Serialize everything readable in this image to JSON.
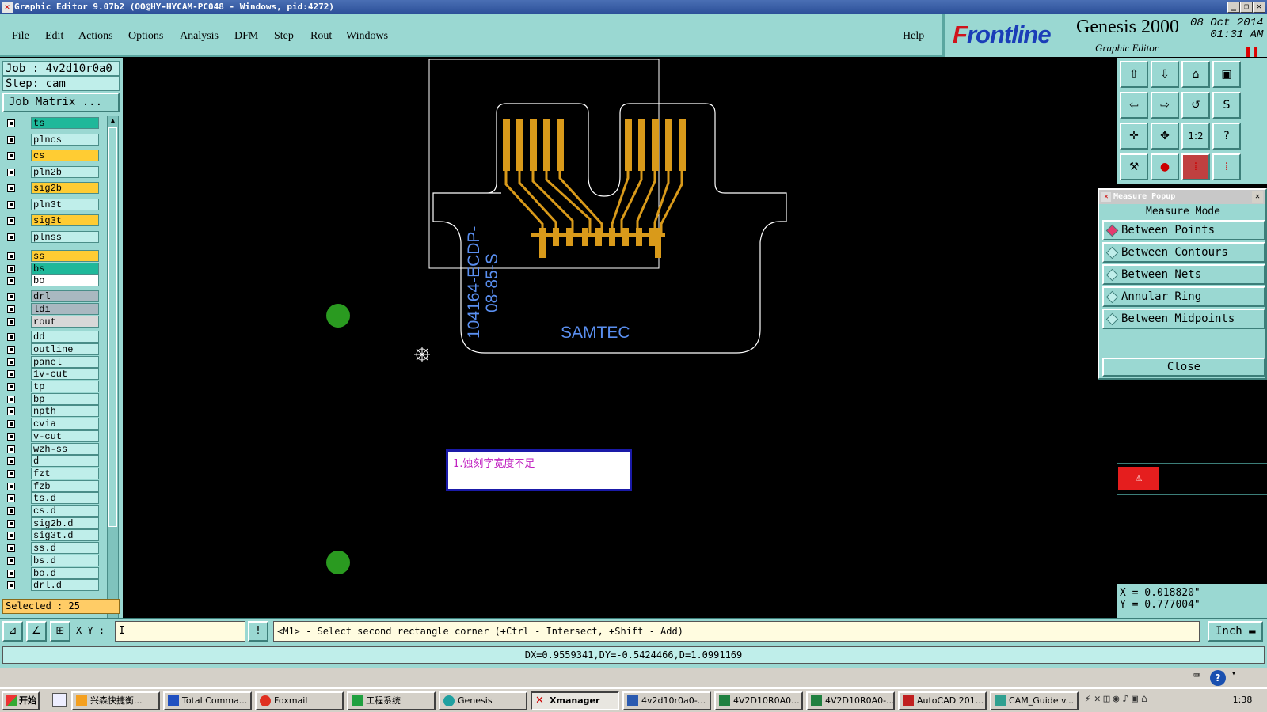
{
  "window": {
    "title": "Graphic Editor 9.07b2 (OO@HY-HYCAM-PC048 - Windows, pid:4272)"
  },
  "menu": {
    "items": [
      "File",
      "Edit",
      "Actions",
      "Options",
      "Analysis",
      "DFM",
      "Step",
      "Rout",
      "Windows"
    ],
    "help": "Help"
  },
  "brand": {
    "logo_prefix": "F",
    "logo_rest": "rontline",
    "product": "Genesis 2000",
    "subtitle": "Graphic Editor",
    "date": "08 Oct 2014",
    "time": "01:31 AM"
  },
  "job": {
    "job_line": "Job : 4v2d10r0a0",
    "step_line": "Step: cam",
    "matrix_button": "Job Matrix ...",
    "selected": "Selected : 25"
  },
  "layers": [
    {
      "name": "ts",
      "color": "#1fb89a"
    },
    {
      "name": "plncs",
      "color": "#bfeeea"
    },
    {
      "name": "cs",
      "color": "#ffcc33"
    },
    {
      "name": "pln2b",
      "color": "#bfeeea"
    },
    {
      "name": "sig2b",
      "color": "#ffcc33"
    },
    {
      "name": "pln3t",
      "color": "#bfeeea"
    },
    {
      "name": "sig3t",
      "color": "#ffcc33"
    },
    {
      "name": "plnss",
      "color": "#bfeeea"
    },
    {
      "name": "ss",
      "color": "#ffcc33"
    },
    {
      "name": "bs",
      "color": "#1fb89a"
    },
    {
      "name": "bo",
      "color": "#ffffff"
    },
    {
      "name": "drl",
      "color": "#a9b8c0"
    },
    {
      "name": "ldi",
      "color": "#a9b8c0"
    },
    {
      "name": "rout",
      "color": "#d8d8d8"
    },
    {
      "name": "dd",
      "color": "#bfeeea"
    },
    {
      "name": "outline",
      "color": "#bfeeea"
    },
    {
      "name": "panel",
      "color": "#bfeeea"
    },
    {
      "name": "1v-cut",
      "color": "#bfeeea"
    },
    {
      "name": "tp",
      "color": "#bfeeea"
    },
    {
      "name": "bp",
      "color": "#bfeeea"
    },
    {
      "name": "npth",
      "color": "#bfeeea"
    },
    {
      "name": "cvia",
      "color": "#bfeeea"
    },
    {
      "name": "v-cut",
      "color": "#bfeeea"
    },
    {
      "name": "wzh-ss",
      "color": "#bfeeea"
    },
    {
      "name": "d",
      "color": "#bfeeea"
    },
    {
      "name": "fzt",
      "color": "#bfeeea"
    },
    {
      "name": "fzb",
      "color": "#bfeeea"
    },
    {
      "name": "ts.d",
      "color": "#bfeeea"
    },
    {
      "name": "cs.d",
      "color": "#bfeeea"
    },
    {
      "name": "sig2b.d",
      "color": "#bfeeea"
    },
    {
      "name": "sig3t.d",
      "color": "#bfeeea"
    },
    {
      "name": "ss.d",
      "color": "#bfeeea"
    },
    {
      "name": "bs.d",
      "color": "#bfeeea"
    },
    {
      "name": "bo.d",
      "color": "#bfeeea"
    },
    {
      "name": "drl.d",
      "color": "#bfeeea"
    }
  ],
  "canvas": {
    "silk_vertical_1": "104164-ECDP-",
    "silk_vertical_2": "08-85-S",
    "silk_brand": "SAMTEC",
    "note": "1.蚀刻字宽度不足"
  },
  "measure_popup": {
    "title": "Measure Popup",
    "mode_label": "Measure Mode",
    "options": [
      "Between Points",
      "Between Contours",
      "Between Nets",
      "Annular Ring",
      "Between Midpoints"
    ],
    "close": "Close"
  },
  "coords": {
    "x": "X = 0.018820\"",
    "y": "Y = 0.777004\""
  },
  "command": {
    "xy_label": "X Y :",
    "xy_value": "I",
    "prompt": "<M1> - Select second rectangle corner (+Ctrl - Intersect, +Shift - Add)",
    "units": "Inch"
  },
  "status": {
    "measure": "DX=0.9559341,DY=-0.5424466,D=1.0991169"
  },
  "taskbar": {
    "start": "开始",
    "tasks": [
      "兴森快捷衡...",
      "Total Comma...",
      "Foxmail",
      "工程系统",
      "Genesis",
      "Xmanager",
      "4v2d10r0a0-...",
      "4V2D10R0A0...",
      "4V2D10R0A0-...",
      "AutoCAD 201...",
      "CAM_Guide v..."
    ],
    "clock": "1:38"
  }
}
